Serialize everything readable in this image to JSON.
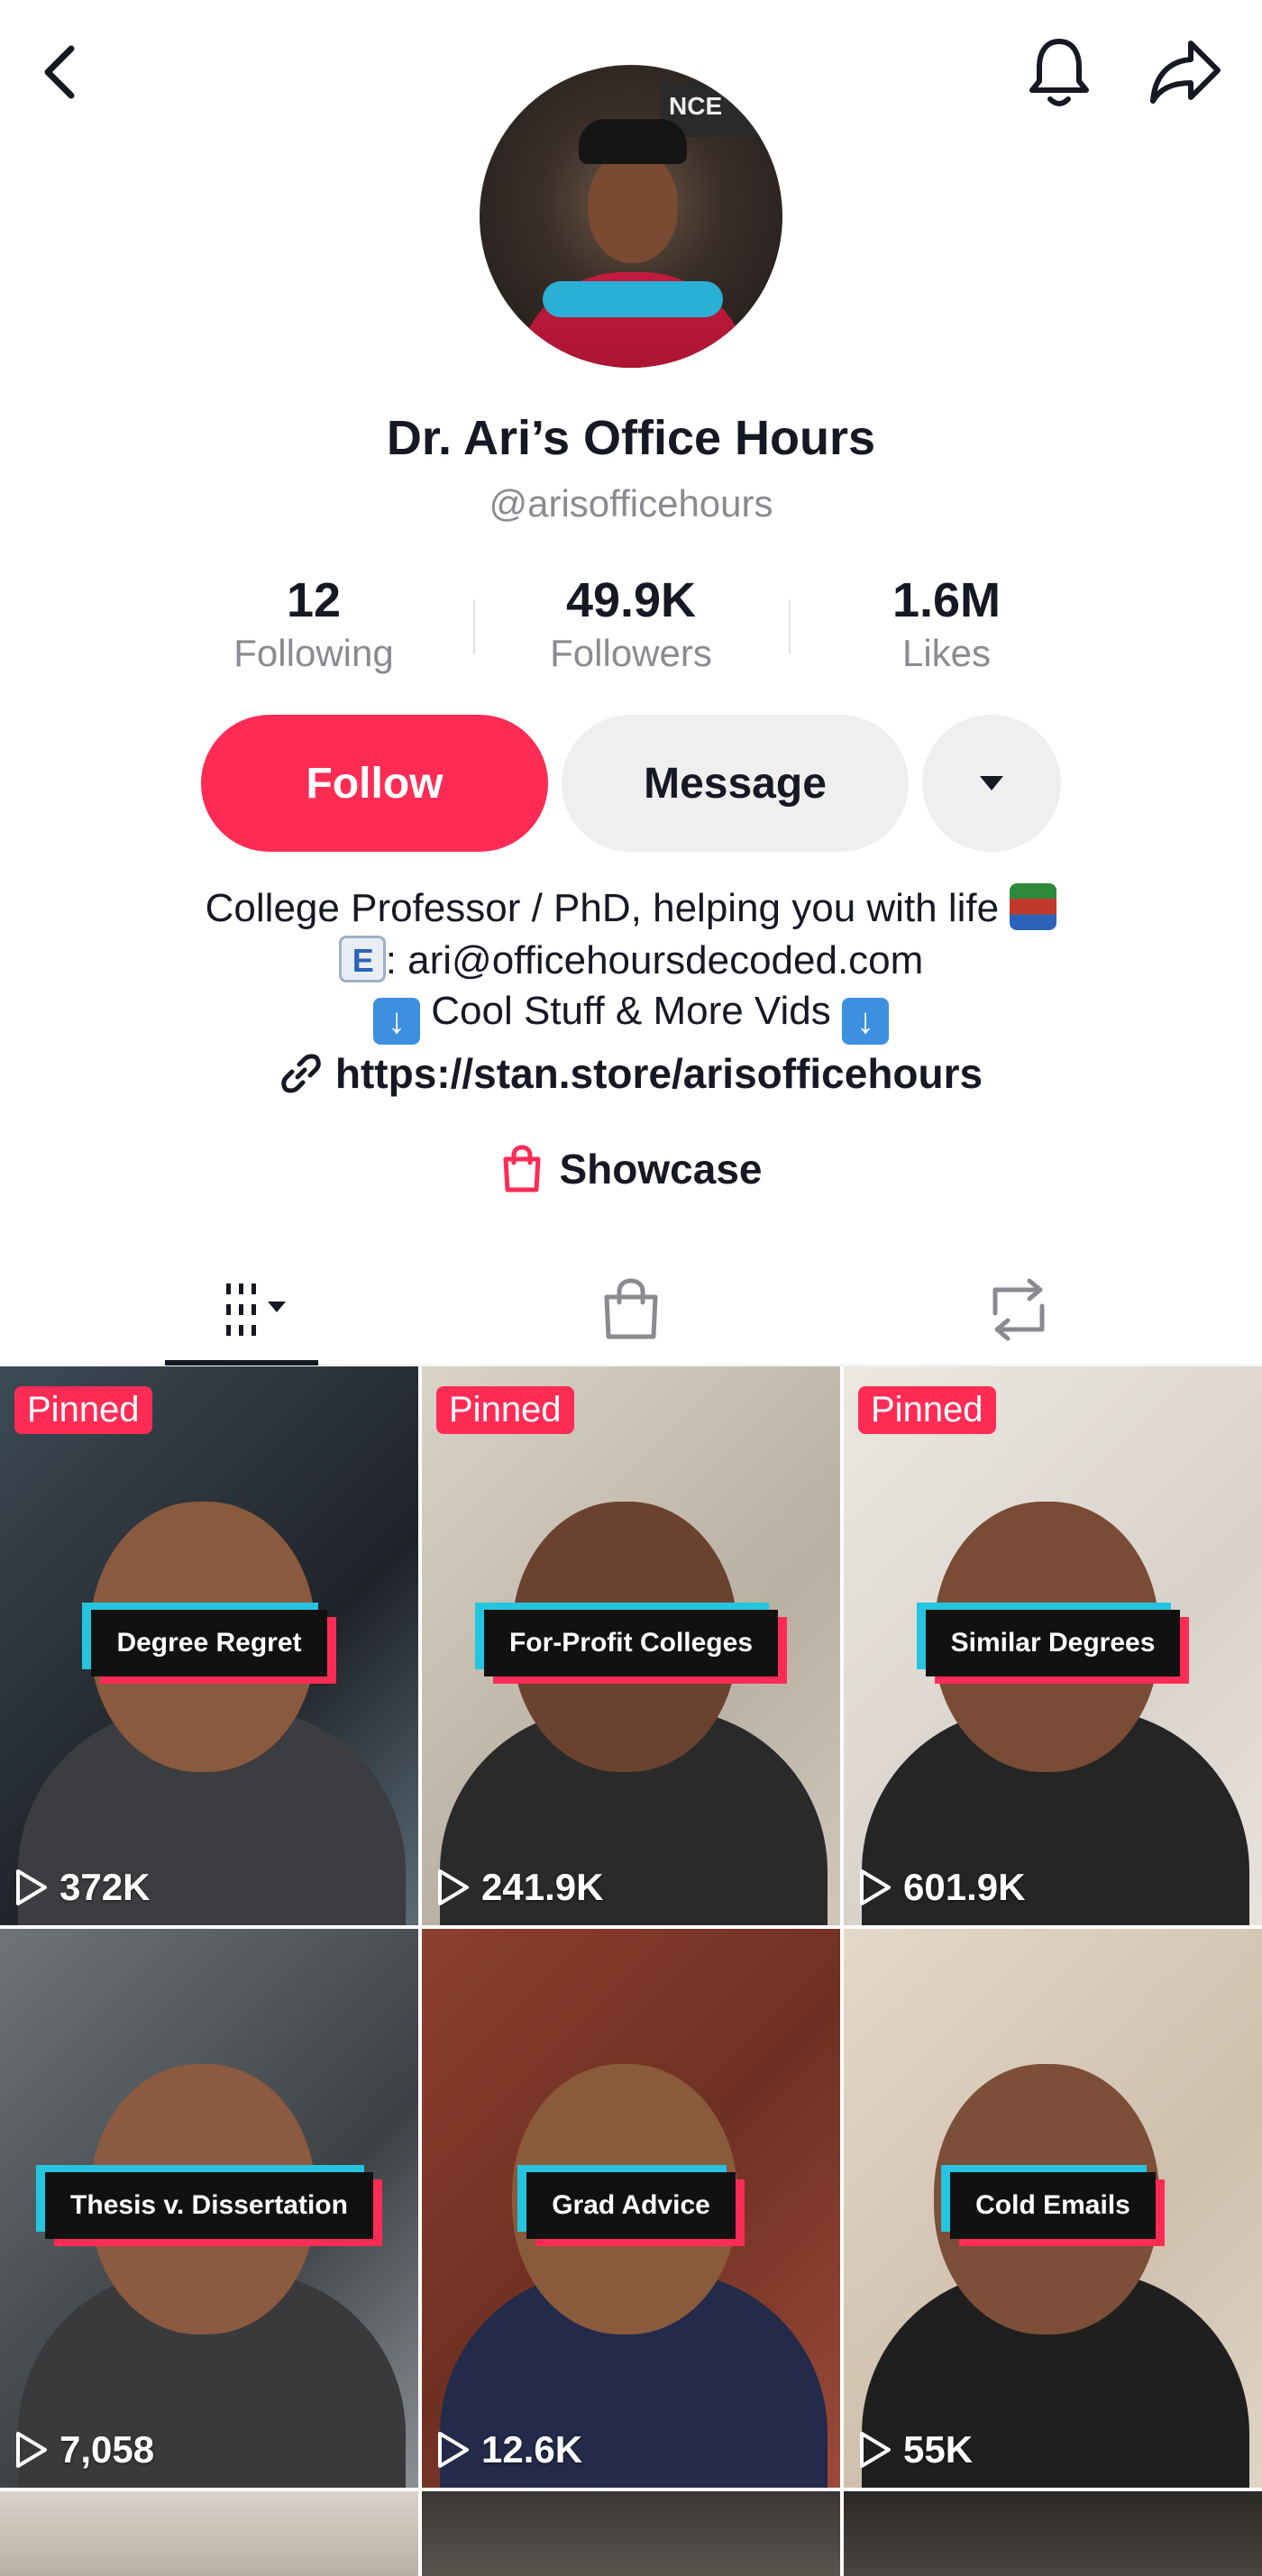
{
  "profile": {
    "name": "Dr. Ari’s Office Hours",
    "handle": "@arisofficehours",
    "avatar_sign_text": "NCE"
  },
  "stats": {
    "following": {
      "value": "12",
      "label": "Following"
    },
    "followers": {
      "value": "49.9K",
      "label": "Followers"
    },
    "likes": {
      "value": "1.6M",
      "label": "Likes"
    }
  },
  "actions": {
    "follow_label": "Follow",
    "message_label": "Message"
  },
  "bio": {
    "line1": "College Professor / PhD, helping you with life",
    "line2": ": ari@officehoursdecoded.com",
    "line3": "Cool Stuff & More Vids",
    "link": "https://stan.store/arisofficehours"
  },
  "showcase_label": "Showcase",
  "colors": {
    "accent": "#fe2c55",
    "caption_cyan": "#25c5e0",
    "muted_text": "#8a8b91"
  },
  "videos": [
    {
      "pinned": "Pinned",
      "caption": "Degree Regret",
      "views": "372K"
    },
    {
      "pinned": "Pinned",
      "caption": "For-Profit Colleges",
      "views": "241.9K"
    },
    {
      "pinned": "Pinned",
      "caption": "Similar Degrees",
      "views": "601.9K"
    },
    {
      "pinned": "",
      "caption": "Thesis v. Dissertation",
      "views": "7,058"
    },
    {
      "pinned": "",
      "caption": "Grad Advice",
      "views": "12.6K"
    },
    {
      "pinned": "",
      "caption": "Cold Emails",
      "views": "55K"
    }
  ]
}
